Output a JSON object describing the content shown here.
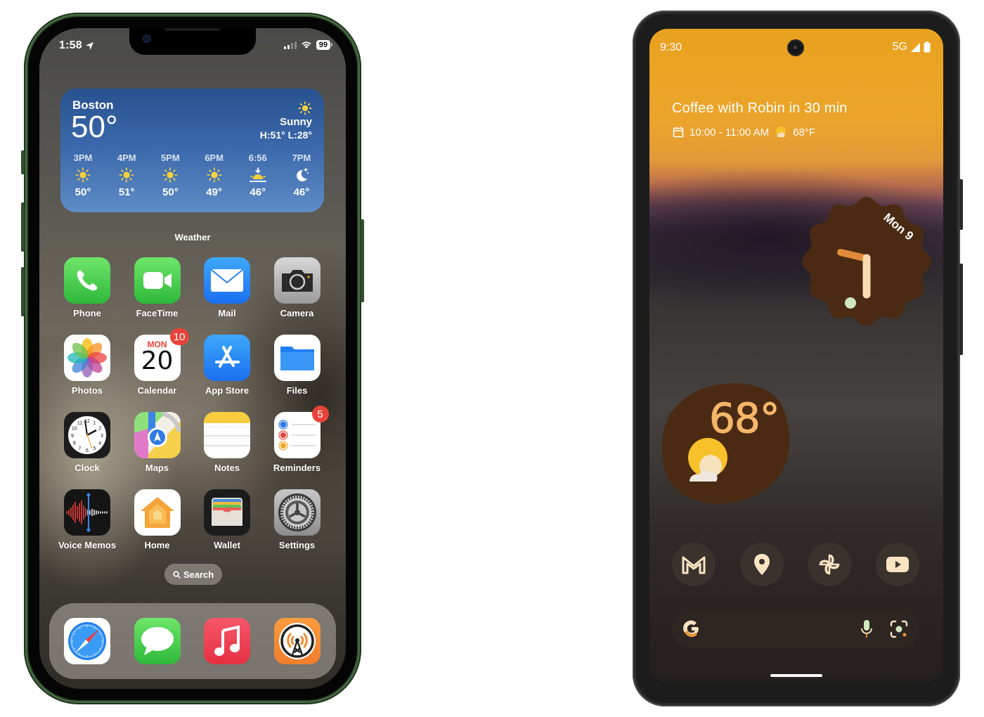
{
  "iphone": {
    "status": {
      "time": "1:58",
      "battery": "99",
      "location_icon": "location-arrow-icon",
      "signal_bars_active": 2,
      "signal_bars_total": 4
    },
    "weather_widget": {
      "city": "Boston",
      "temperature": "50°",
      "condition": "Sunny",
      "high_low": "H:51° L:28°",
      "label": "Weather",
      "hourly": [
        {
          "time": "3PM",
          "icon": "sun-icon",
          "temp": "50°"
        },
        {
          "time": "4PM",
          "icon": "sun-icon",
          "temp": "51°"
        },
        {
          "time": "5PM",
          "icon": "sun-icon",
          "temp": "50°"
        },
        {
          "time": "6PM",
          "icon": "sun-icon",
          "temp": "49°"
        },
        {
          "time": "6:56",
          "icon": "sunset-icon",
          "temp": "46°"
        },
        {
          "time": "7PM",
          "icon": "moon-stars-icon",
          "temp": "46°"
        }
      ]
    },
    "apps": [
      {
        "name": "Phone"
      },
      {
        "name": "FaceTime"
      },
      {
        "name": "Mail"
      },
      {
        "name": "Camera"
      },
      {
        "name": "Photos"
      },
      {
        "name": "Calendar",
        "badge": "10",
        "weekday": "MON",
        "day": "20"
      },
      {
        "name": "App Store"
      },
      {
        "name": "Files"
      },
      {
        "name": "Clock"
      },
      {
        "name": "Maps"
      },
      {
        "name": "Notes"
      },
      {
        "name": "Reminders",
        "badge": "5"
      },
      {
        "name": "Voice Memos"
      },
      {
        "name": "Home"
      },
      {
        "name": "Wallet"
      },
      {
        "name": "Settings"
      }
    ],
    "search_label": "Search",
    "dock": [
      {
        "name": "Safari"
      },
      {
        "name": "Messages"
      },
      {
        "name": "Music"
      },
      {
        "name": "Overcast"
      }
    ],
    "colors": {
      "frame": "#2d4a2b",
      "badge": "#e8433a",
      "weather_top": "#28528f",
      "weather_bottom": "#5e8cc6"
    }
  },
  "pixel": {
    "status": {
      "time": "9:30",
      "network": "5G"
    },
    "at_a_glance": {
      "event": "Coffee with Robin in 30 min",
      "event_time": "10:00 - 11:00 AM",
      "weather": "68°F"
    },
    "clock_widget": {
      "date": "Mon 9",
      "hour": 9,
      "minute": 30
    },
    "weather_widget": {
      "temperature": "68°",
      "icon": "partly-sunny-icon"
    },
    "dock": [
      {
        "name": "Gmail",
        "icon": "gmail-icon"
      },
      {
        "name": "Maps",
        "icon": "map-pin-icon"
      },
      {
        "name": "Photos",
        "icon": "pinwheel-icon"
      },
      {
        "name": "YouTube",
        "icon": "youtube-icon"
      }
    ],
    "search_bar": {
      "logo": "google-g-icon",
      "mic": "mic-icon",
      "lens": "lens-icon"
    },
    "colors": {
      "accent": "#f5b66a",
      "widget": "#4a2a12",
      "dock_icon_bg": "#3a322d"
    }
  }
}
